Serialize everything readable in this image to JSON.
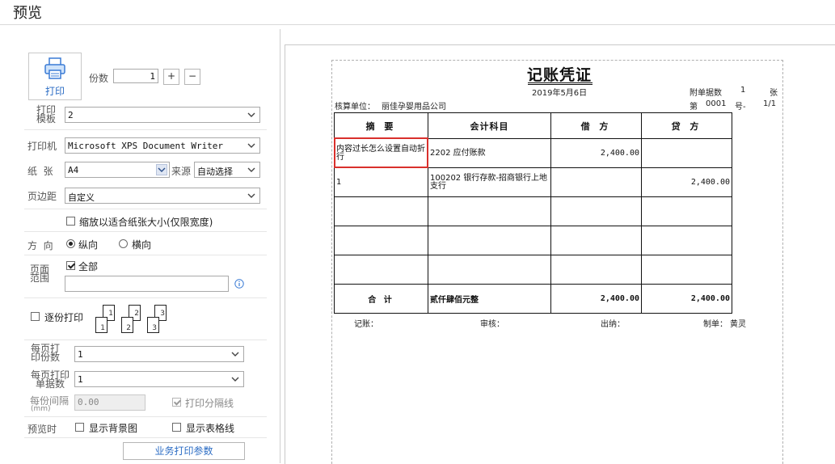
{
  "window": {
    "title": "预览"
  },
  "settings": {
    "print_button": "打印",
    "copies": {
      "label": "份数",
      "value": "1",
      "plus": "+",
      "minus": "−"
    },
    "template": {
      "label": "打印模板",
      "value": "2"
    },
    "printer": {
      "label": "打印机",
      "value": "Microsoft XPS Document Writer"
    },
    "paper": {
      "label": "纸  张",
      "value": "A4",
      "source_label": "来源",
      "source_value": "自动选择"
    },
    "margin": {
      "label": "页边距",
      "value": "自定义"
    },
    "fit_paper": {
      "label": "缩放以适合纸张大小(仅限宽度)",
      "checked": false
    },
    "orientation": {
      "label": "方  向",
      "portrait": "纵向",
      "landscape": "横向",
      "selected": "portrait"
    },
    "page_range": {
      "label": "页面范围",
      "all_label": "全部",
      "all_checked": true,
      "value": ""
    },
    "collate": {
      "label": "逐份打印",
      "checked": false,
      "pages": [
        "1",
        "1",
        "2",
        "2",
        "3",
        "3"
      ]
    },
    "copies_per_page": {
      "label": "每页打印份数",
      "value": "1"
    },
    "vouchers_per_page": {
      "label": "每页打印单据数",
      "value": "1"
    },
    "spacing": {
      "label": "每份间隔",
      "unit": "(mm)",
      "value": "0.00"
    },
    "print_divider": {
      "label": "打印分隔线",
      "checked": true
    },
    "preview_when": {
      "label": "预览时",
      "show_bg": {
        "label": "显示背景图",
        "checked": false
      },
      "show_grid": {
        "label": "显示表格线",
        "checked": false
      }
    },
    "business_params_button": "业务打印参数"
  },
  "voucher": {
    "title": "记账凭证",
    "date": "2019年5月6日",
    "attachments_label": "附单据数",
    "attachments_count": "1",
    "attachments_unit": "张",
    "unit_label": "核算单位：",
    "unit_name": "丽佳孕婴用品公司",
    "number_label": "第",
    "number_value": "0001",
    "number_suffix": "号-",
    "page": "1/1",
    "headers": [
      "摘 要",
      "会计科目",
      "借 方",
      "贷 方"
    ],
    "rows": [
      {
        "summary": "内容过长怎么设置自动折行",
        "account": "2202 应付账款",
        "debit": "2,400.00",
        "credit": ""
      },
      {
        "summary": "1",
        "account": "100202 银行存款-招商银行上地支行",
        "debit": "",
        "credit": "2,400.00"
      },
      {
        "summary": "",
        "account": "",
        "debit": "",
        "credit": ""
      },
      {
        "summary": "",
        "account": "",
        "debit": "",
        "credit": ""
      },
      {
        "summary": "",
        "account": "",
        "debit": "",
        "credit": ""
      }
    ],
    "total": {
      "label": "合 计",
      "words": "贰仟肆佰元整",
      "debit": "2,400.00",
      "credit": "2,400.00"
    },
    "footer": {
      "bookkeeper": "记账：",
      "reviewer": "审核：",
      "cashier": "出纳：",
      "preparer_label": "制单：",
      "preparer": "黄灵"
    }
  },
  "colors": {
    "accent": "#2b6cc4",
    "highlight": "#d9302c"
  }
}
